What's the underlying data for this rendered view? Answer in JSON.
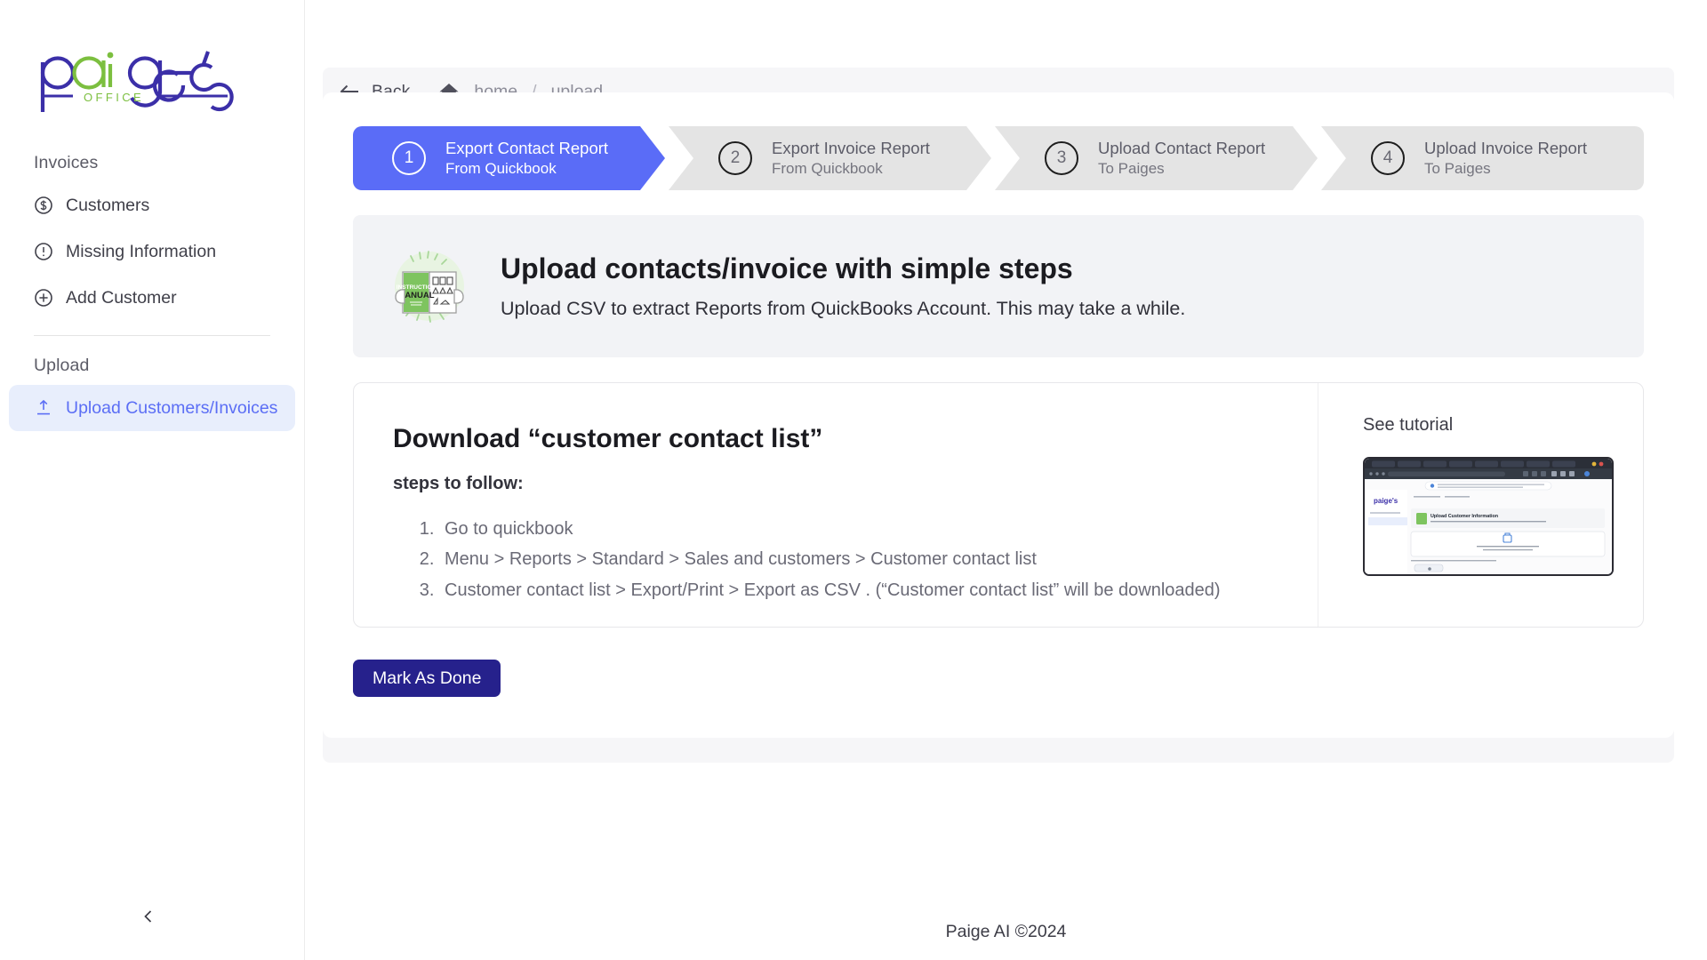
{
  "window": {
    "more_menu": "···"
  },
  "brand": {
    "name": "paige's",
    "subtitle": "OFFICE",
    "color_primary": "#3b2fa8",
    "color_accent": "#7cbf3f"
  },
  "sidebar": {
    "sections": [
      {
        "title": "Invoices",
        "items": [
          {
            "label": "Customers",
            "icon": "dollar-circle-icon",
            "active": false
          },
          {
            "label": "Missing Information",
            "icon": "alert-circle-icon",
            "active": false
          },
          {
            "label": "Add Customer",
            "icon": "plus-circle-icon",
            "active": false
          }
        ]
      },
      {
        "title": "Upload",
        "items": [
          {
            "label": "Upload Customers/Invoices",
            "icon": "upload-icon",
            "active": true
          }
        ]
      }
    ],
    "collapse_icon": "chevron-left-icon"
  },
  "breadcrumb": {
    "back_label": "Back",
    "back_icon": "arrow-left-icon",
    "home_icon": "home-icon",
    "crumbs": [
      "home",
      "upload"
    ],
    "separator": "/"
  },
  "stepper": {
    "active_index": 0,
    "steps": [
      {
        "number": "1",
        "title": "Export Contact Report",
        "subtitle": "From Quickbook"
      },
      {
        "number": "2",
        "title": "Export Invoice Report",
        "subtitle": "From Quickbook"
      },
      {
        "number": "3",
        "title": "Upload Contact Report",
        "subtitle": "To Paiges"
      },
      {
        "number": "4",
        "title": "Upload Invoice Report",
        "subtitle": "To Paiges"
      }
    ]
  },
  "info_banner": {
    "icon": "instruction-manual-icon",
    "icon_text_line1": "INSTRUCTION",
    "icon_text_line2": "MANUAL",
    "title": "Upload contacts/invoice with simple steps",
    "subtitle": "Upload CSV to extract Reports from QuickBooks Account. This may take a while."
  },
  "download_card": {
    "title": "Download “customer contact list”",
    "steps_label": "steps to follow:",
    "steps": [
      "Go to quickbook",
      "Menu > Reports > Standard > Sales and customers > Customer contact list",
      "Customer contact list > Export/Print > Export as CSV . (“Customer contact list” will be downloaded)"
    ],
    "tutorial_label": "See tutorial",
    "tutorial_thumb_name": "tutorial-video-thumbnail"
  },
  "actions": {
    "mark_as_done": "Mark As Done"
  },
  "footer": {
    "text": "Paige AI ©2024"
  }
}
